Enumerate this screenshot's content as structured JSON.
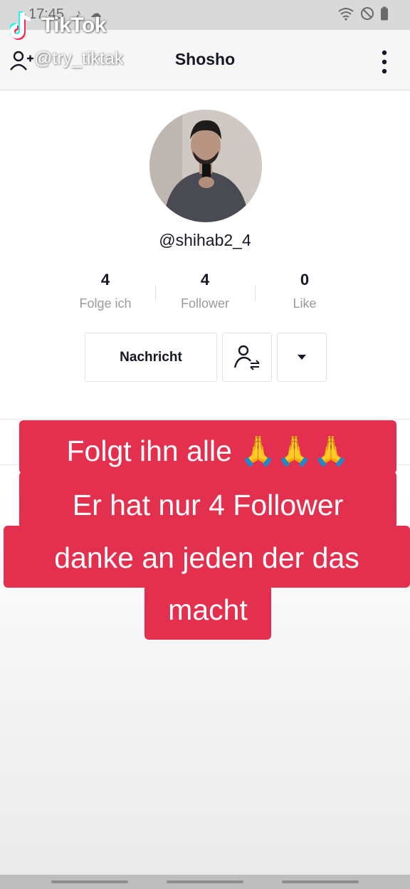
{
  "status_bar": {
    "time": "17:45",
    "notification_icons": [
      "tiktok-icon",
      "weather-icon"
    ],
    "right_icons": [
      "wifi-icon",
      "do-not-disturb-icon",
      "battery-icon"
    ]
  },
  "watermark": {
    "brand": "TikTok",
    "handle": "@try_tiktak"
  },
  "header": {
    "title": "Shosho"
  },
  "profile": {
    "username": "@shihab2_4",
    "stats": [
      {
        "value": "4",
        "label": "Folge ich"
      },
      {
        "value": "4",
        "label": "Follower"
      },
      {
        "value": "0",
        "label": "Like"
      }
    ],
    "message_button": "Nachricht"
  },
  "caption": {
    "lines": [
      "Folgt ihn alle 🙏🙏🙏",
      "Er hat nur 4 Follower",
      "danke an jeden der das",
      "macht"
    ],
    "background": "#e3304f"
  },
  "colors": {
    "text_primary": "#161823",
    "text_secondary": "#9a9a9a",
    "tiktok_cyan": "#25f4ee",
    "tiktok_red": "#fe2c55"
  }
}
